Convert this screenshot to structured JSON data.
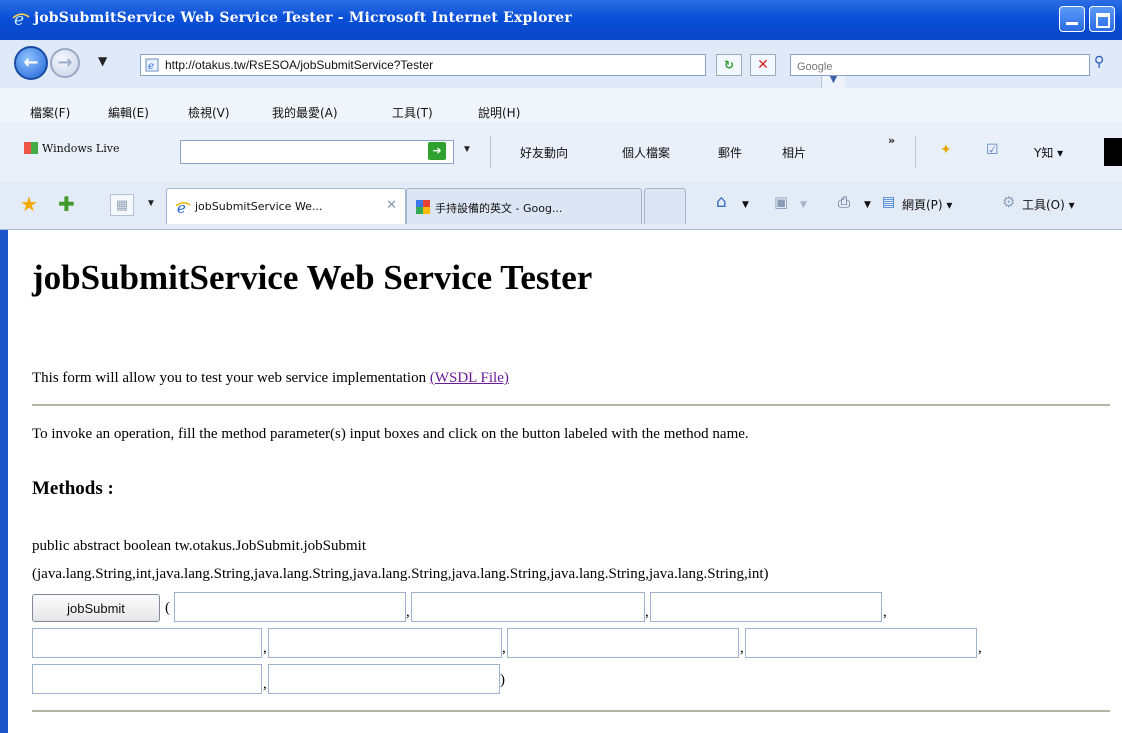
{
  "window": {
    "title": "jobSubmitService Web Service Tester - Microsoft Internet Explorer"
  },
  "address_bar": {
    "url": "http://otakus.tw/RsESOA/jobSubmitService?Tester",
    "search_placeholder": "Google"
  },
  "menu": {
    "items": [
      "檔案(F)",
      "編輯(E)",
      "檢視(V)",
      "我的最愛(A)",
      "工具(T)",
      "說明(H)"
    ]
  },
  "live_toolbar": {
    "brand": "Windows Live",
    "items": [
      "好友動向",
      "個人檔案",
      "郵件",
      "相片"
    ],
    "chevron": "»",
    "yahoo_label": "Y知 ▾"
  },
  "tabs": {
    "active_label": "jobSubmitService We...",
    "inactive_label": "手持設備的英文 - Goog...",
    "commands": [
      "網頁(P) ▾",
      "工具(O) ▾"
    ]
  },
  "page": {
    "heading": "jobSubmitService Web Service Tester",
    "intro": "This form will allow you to test your web service implementation ",
    "wsdl_link": "(WSDL File)",
    "instructions": "To invoke an operation, fill the method parameter(s) input boxes and click on the button labeled with the method name.",
    "methods_heading": "Methods :",
    "method_signature_1": "public abstract boolean tw.otakus.JobSubmit.jobSubmit",
    "method_signature_2": "(java.lang.String,int,java.lang.String,java.lang.String,java.lang.String,java.lang.String,java.lang.String,java.lang.String,int)",
    "submit_label": "jobSubmit",
    "open_paren": "(",
    "comma": ",",
    "close_paren": ")"
  }
}
